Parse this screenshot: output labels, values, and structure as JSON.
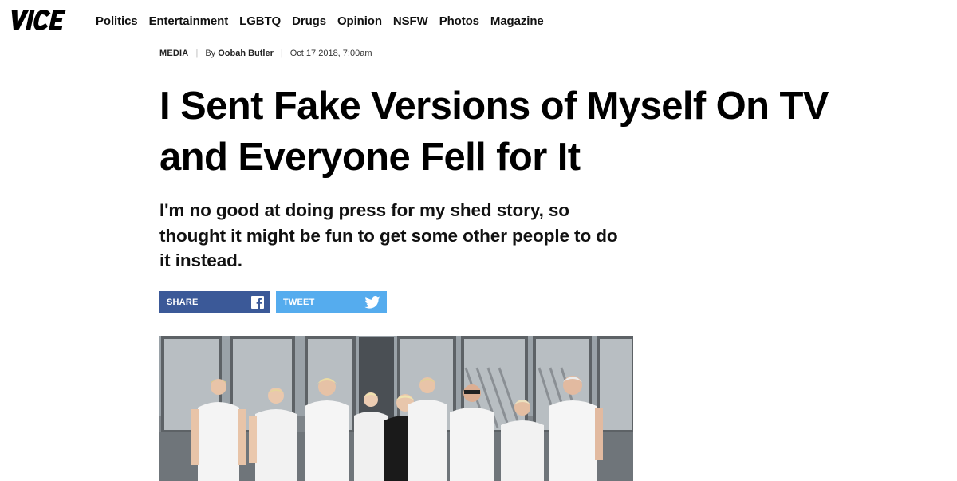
{
  "header": {
    "logo_text": "VICE",
    "nav": [
      "Politics",
      "Entertainment",
      "LGBTQ",
      "Drugs",
      "Opinion",
      "NSFW",
      "Photos",
      "Magazine"
    ]
  },
  "article": {
    "section": "MEDIA",
    "byline_prefix": "By",
    "author": "Oobah Butler",
    "date": "Oct 17 2018, 7:00am",
    "headline": "I Sent Fake Versions of Myself On TV and Everyone Fell for It",
    "dek": "I'm no good at doing press for my shed story, so thought it might be fun to get some other people to do it instead."
  },
  "share": {
    "facebook_label": "SHARE",
    "twitter_label": "TWEET",
    "facebook_icon": "facebook-icon",
    "twitter_icon": "twitter-icon"
  },
  "hero": {
    "description_icon": "hero-photo"
  },
  "colors": {
    "facebook": "#3b5998",
    "twitter": "#55acee",
    "divider": "#e6e6e6"
  }
}
